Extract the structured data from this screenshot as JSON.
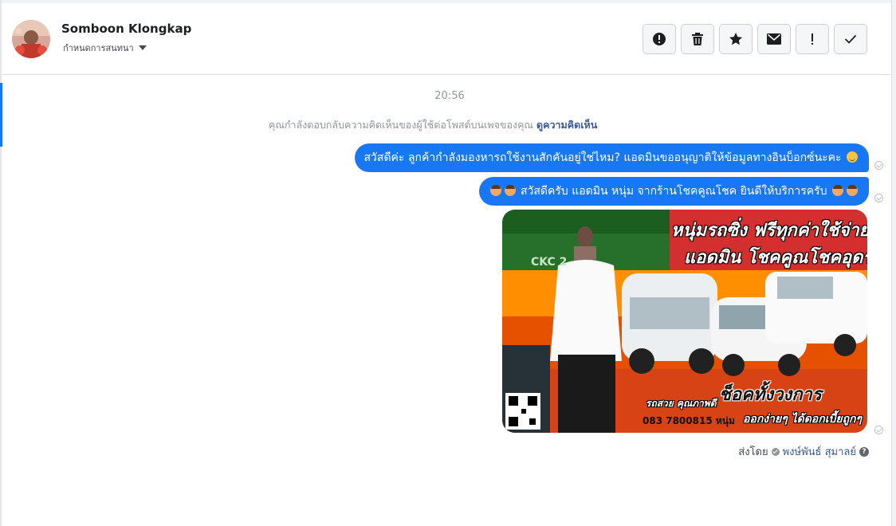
{
  "header": {
    "contact_name": "Somboon Klongkap",
    "assign_label": "กำหนดการสนทนา",
    "actions": [
      {
        "name": "report-spam",
        "icon": "alert-circle-icon"
      },
      {
        "name": "delete",
        "icon": "trash-icon"
      },
      {
        "name": "star",
        "icon": "star-icon"
      },
      {
        "name": "mark-unread",
        "icon": "envelope-icon"
      },
      {
        "name": "follow-up",
        "icon": "exclamation-icon"
      },
      {
        "name": "mark-done",
        "icon": "check-icon"
      }
    ]
  },
  "conversation": {
    "timestamp": "20:56",
    "notice_text": "คุณกำลังตอบกลับความคิดเห็นของผู้ใช้ต่อโพสต์บนเพจของคุณ",
    "notice_link": "ดูความคิดเห็น",
    "messages": [
      {
        "text": "สวัสดีค่ะ ลูกค้ากำลังมองหารถใช้งานสักคันอยู่ใช่ไหม? แอดมินขออนุญาติให้ข้อมูลทางอินบ็อกซ์นะคะ",
        "emoji_after": "smiling-face-emoji"
      },
      {
        "text": "สวัสดีครับ แอดมิน หนุ่ม จากร้านโชคคูณโชค ยินดีให้บริการครับ",
        "emoji_before": "man-emoji",
        "emoji_after": "man-emoji"
      }
    ],
    "image": {
      "headline_1": "หนุ่มรถซิ่ง ฟรีทุกค่าใช้จ่าย",
      "headline_2": "แอดมิน โชคคูณโชคอุดร",
      "brand": "CKC 2",
      "subline": "รถสวย คุณภาพดี",
      "big_text": "ช็อคทั้งวงการ",
      "phone": "083 7800815 หนุ่ม",
      "tagline": "ออกง่ายๆ ได้ดอกเบี้ยถูกๆ"
    },
    "sent_by_label": "ส่งโดย",
    "agent_name": "พงษ์พันธ์ สุมาลย์"
  },
  "colors": {
    "bubble": "#1877f2",
    "link": "#385898",
    "muted": "#90949c"
  }
}
